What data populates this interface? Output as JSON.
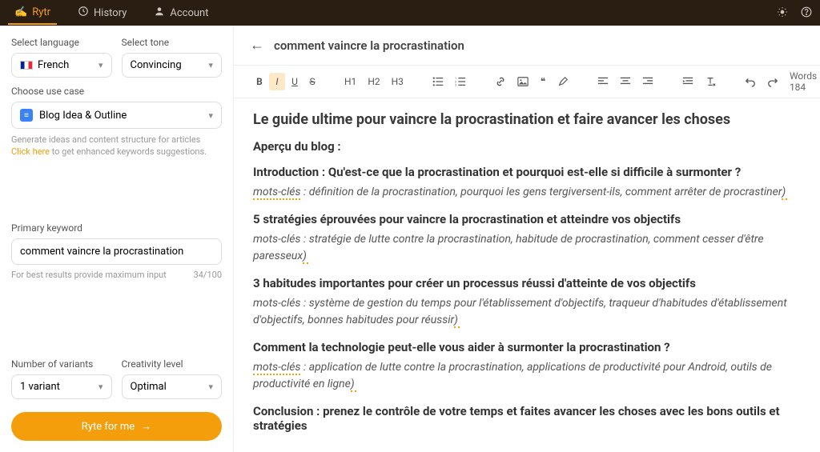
{
  "topbar": {
    "brand": "Rytr",
    "history": "History",
    "account": "Account"
  },
  "sidebar": {
    "language": {
      "label": "Select language",
      "value": "French"
    },
    "tone": {
      "label": "Select tone",
      "value": "Convincing"
    },
    "usecase": {
      "label": "Choose use case",
      "value": "Blog Idea & Outline",
      "helper_line1": "Generate ideas and content structure for articles",
      "helper_link": "Click here",
      "helper_line2": "to get enhanced keywords suggestions."
    },
    "keyword": {
      "label": "Primary keyword",
      "value": "comment vaincre la procrastination",
      "hint": "For best results provide maximum input",
      "counter": "34/100"
    },
    "variants": {
      "label": "Number of variants",
      "value": "1 variant"
    },
    "creativity": {
      "label": "Creativity level",
      "value": "Optimal"
    },
    "cta": "Ryte for me"
  },
  "content": {
    "title": "comment vaincre la procrastination",
    "wordcount": "Words 184",
    "headings": {
      "h_main": "Le guide ultime pour vaincre la procrastination et faire avancer les choses",
      "h_overview": "Aperçu du blog :",
      "h_intro": "Introduction : Qu'est-ce que la procrastination et pourquoi est-elle si difficile à surmonter ?",
      "kw_intro_label": "mots-clés",
      "kw_intro": " : définition de la procrastination, pourquoi les gens tergiversent-ils, comment arrêter de procrastiner",
      "h_strat": "5 stratégies éprouvées pour vaincre la procrastination et atteindre vos objectifs",
      "kw_strat": "mots-clés : stratégie de lutte contre la procrastination, habitude de procrastination, comment cesser d'être paresseux",
      "h_habits": "3 habitudes importantes pour créer un processus réussi d'atteinte de vos objectifs",
      "kw_habits": "mots-clés : système de gestion du temps pour l'établissement d'objectifs, traqueur d'habitudes d'établissement d'objectifs, bonnes habitudes pour réussir",
      "h_tech": "Comment la technologie peut-elle vous aider à surmonter la procrastination ?",
      "kw_tech_label": "mots-clés",
      "kw_tech": " : application de lutte contre la procrastination, applications de productivité pour Android, outils de productivité en ligne",
      "h_conclusion": "Conclusion : prenez le contrôle de votre temps et faites avancer les choses avec les bons outils et stratégies"
    },
    "toolbar": {
      "b": "B",
      "i": "I",
      "u": "U",
      "s": "S",
      "h1": "H1",
      "h2": "H2",
      "h3": "H3"
    }
  }
}
